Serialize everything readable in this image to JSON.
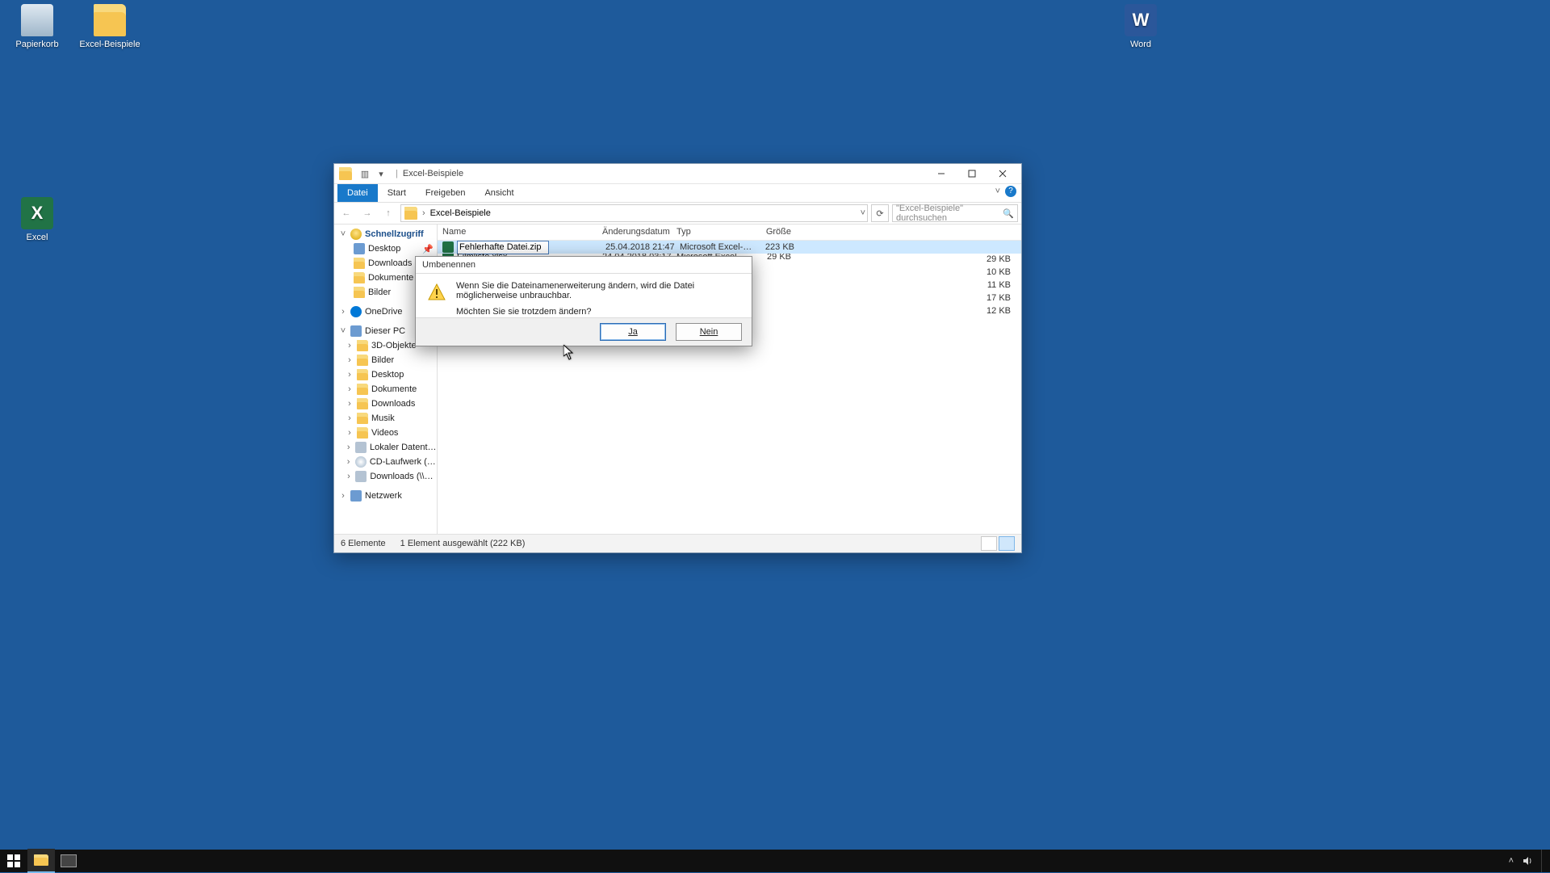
{
  "desktop": {
    "recycle": "Papierkorb",
    "folder": "Excel-Beispiele",
    "word": "Word",
    "excel": "Excel"
  },
  "explorer": {
    "title": "Excel-Beispiele",
    "tabs": {
      "file": "Datei",
      "home": "Start",
      "share": "Freigeben",
      "view": "Ansicht"
    },
    "breadcrumb": "Excel-Beispiele",
    "search_placeholder": "\"Excel-Beispiele\" durchsuchen",
    "columns": {
      "name": "Name",
      "date": "Änderungsdatum",
      "type": "Typ",
      "size": "Größe"
    },
    "nav": {
      "quick": "Schnellzugriff",
      "desktop": "Desktop",
      "downloads": "Downloads",
      "documents": "Dokumente",
      "pictures": "Bilder",
      "onedrive": "OneDrive",
      "thispc": "Dieser PC",
      "objects3d": "3D-Objekte",
      "pictures2": "Bilder",
      "desktop2": "Desktop",
      "documents2": "Dokumente",
      "downloads2": "Downloads",
      "music": "Musik",
      "videos": "Videos",
      "localdisk": "Lokaler Datenträger",
      "cddrive": "CD-Laufwerk (D:) Vi",
      "netdl": "Downloads (\\\\vbox:",
      "network": "Netzwerk"
    },
    "files": [
      {
        "name": "Fehlerhafte Datei.zip",
        "date": "25.04.2018 21:47",
        "type": "Microsoft Excel-Ar...",
        "size": "223 KB",
        "selected": true,
        "renaming": true
      },
      {
        "name": "Filmliste.xlsx",
        "date": "24.04.2018 03:17",
        "type": "Microsoft Excel-Ar...",
        "size": "29 KB"
      },
      {
        "name": "",
        "date": "",
        "type": "",
        "size": "10 KB"
      },
      {
        "name": "",
        "date": "",
        "type": "",
        "size": "11 KB"
      },
      {
        "name": "",
        "date": "",
        "type": "",
        "size": "17 KB"
      },
      {
        "name": "",
        "date": "",
        "type": "",
        "size": "12 KB"
      }
    ],
    "status": {
      "count": "6 Elemente",
      "selection": "1 Element ausgewählt (222 KB)"
    }
  },
  "dialog": {
    "title": "Umbenennen",
    "line1": "Wenn Sie die Dateinamenerweiterung ändern, wird die Datei möglicherweise unbrauchbar.",
    "line2": "Möchten Sie sie trotzdem ändern?",
    "yes": "Ja",
    "no": "Nein"
  }
}
